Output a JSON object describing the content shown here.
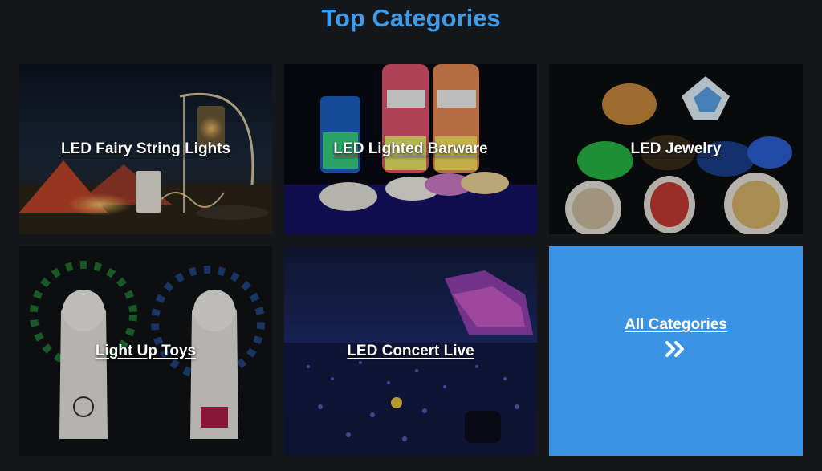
{
  "section": {
    "title": "Top Categories"
  },
  "categories": [
    {
      "label": "LED Fairy String Lights",
      "image": "tent-lantern-string-lights-photo"
    },
    {
      "label": "LED Lighted Barware",
      "image": "glowing-bottles-coasters-photo"
    },
    {
      "label": "LED Jewelry",
      "image": "light-up-badges-pins-photo"
    },
    {
      "label": "Light Up Toys",
      "image": "led-message-fans-photo"
    },
    {
      "label": "LED Concert Live",
      "image": "concert-crowd-lightsticks-photo"
    }
  ],
  "all_categories": {
    "label": "All Categories",
    "icon": "double-chevron-right-icon",
    "color": "#3a93e4"
  },
  "colors": {
    "background": "#16171b",
    "title": "#3d9be9"
  }
}
